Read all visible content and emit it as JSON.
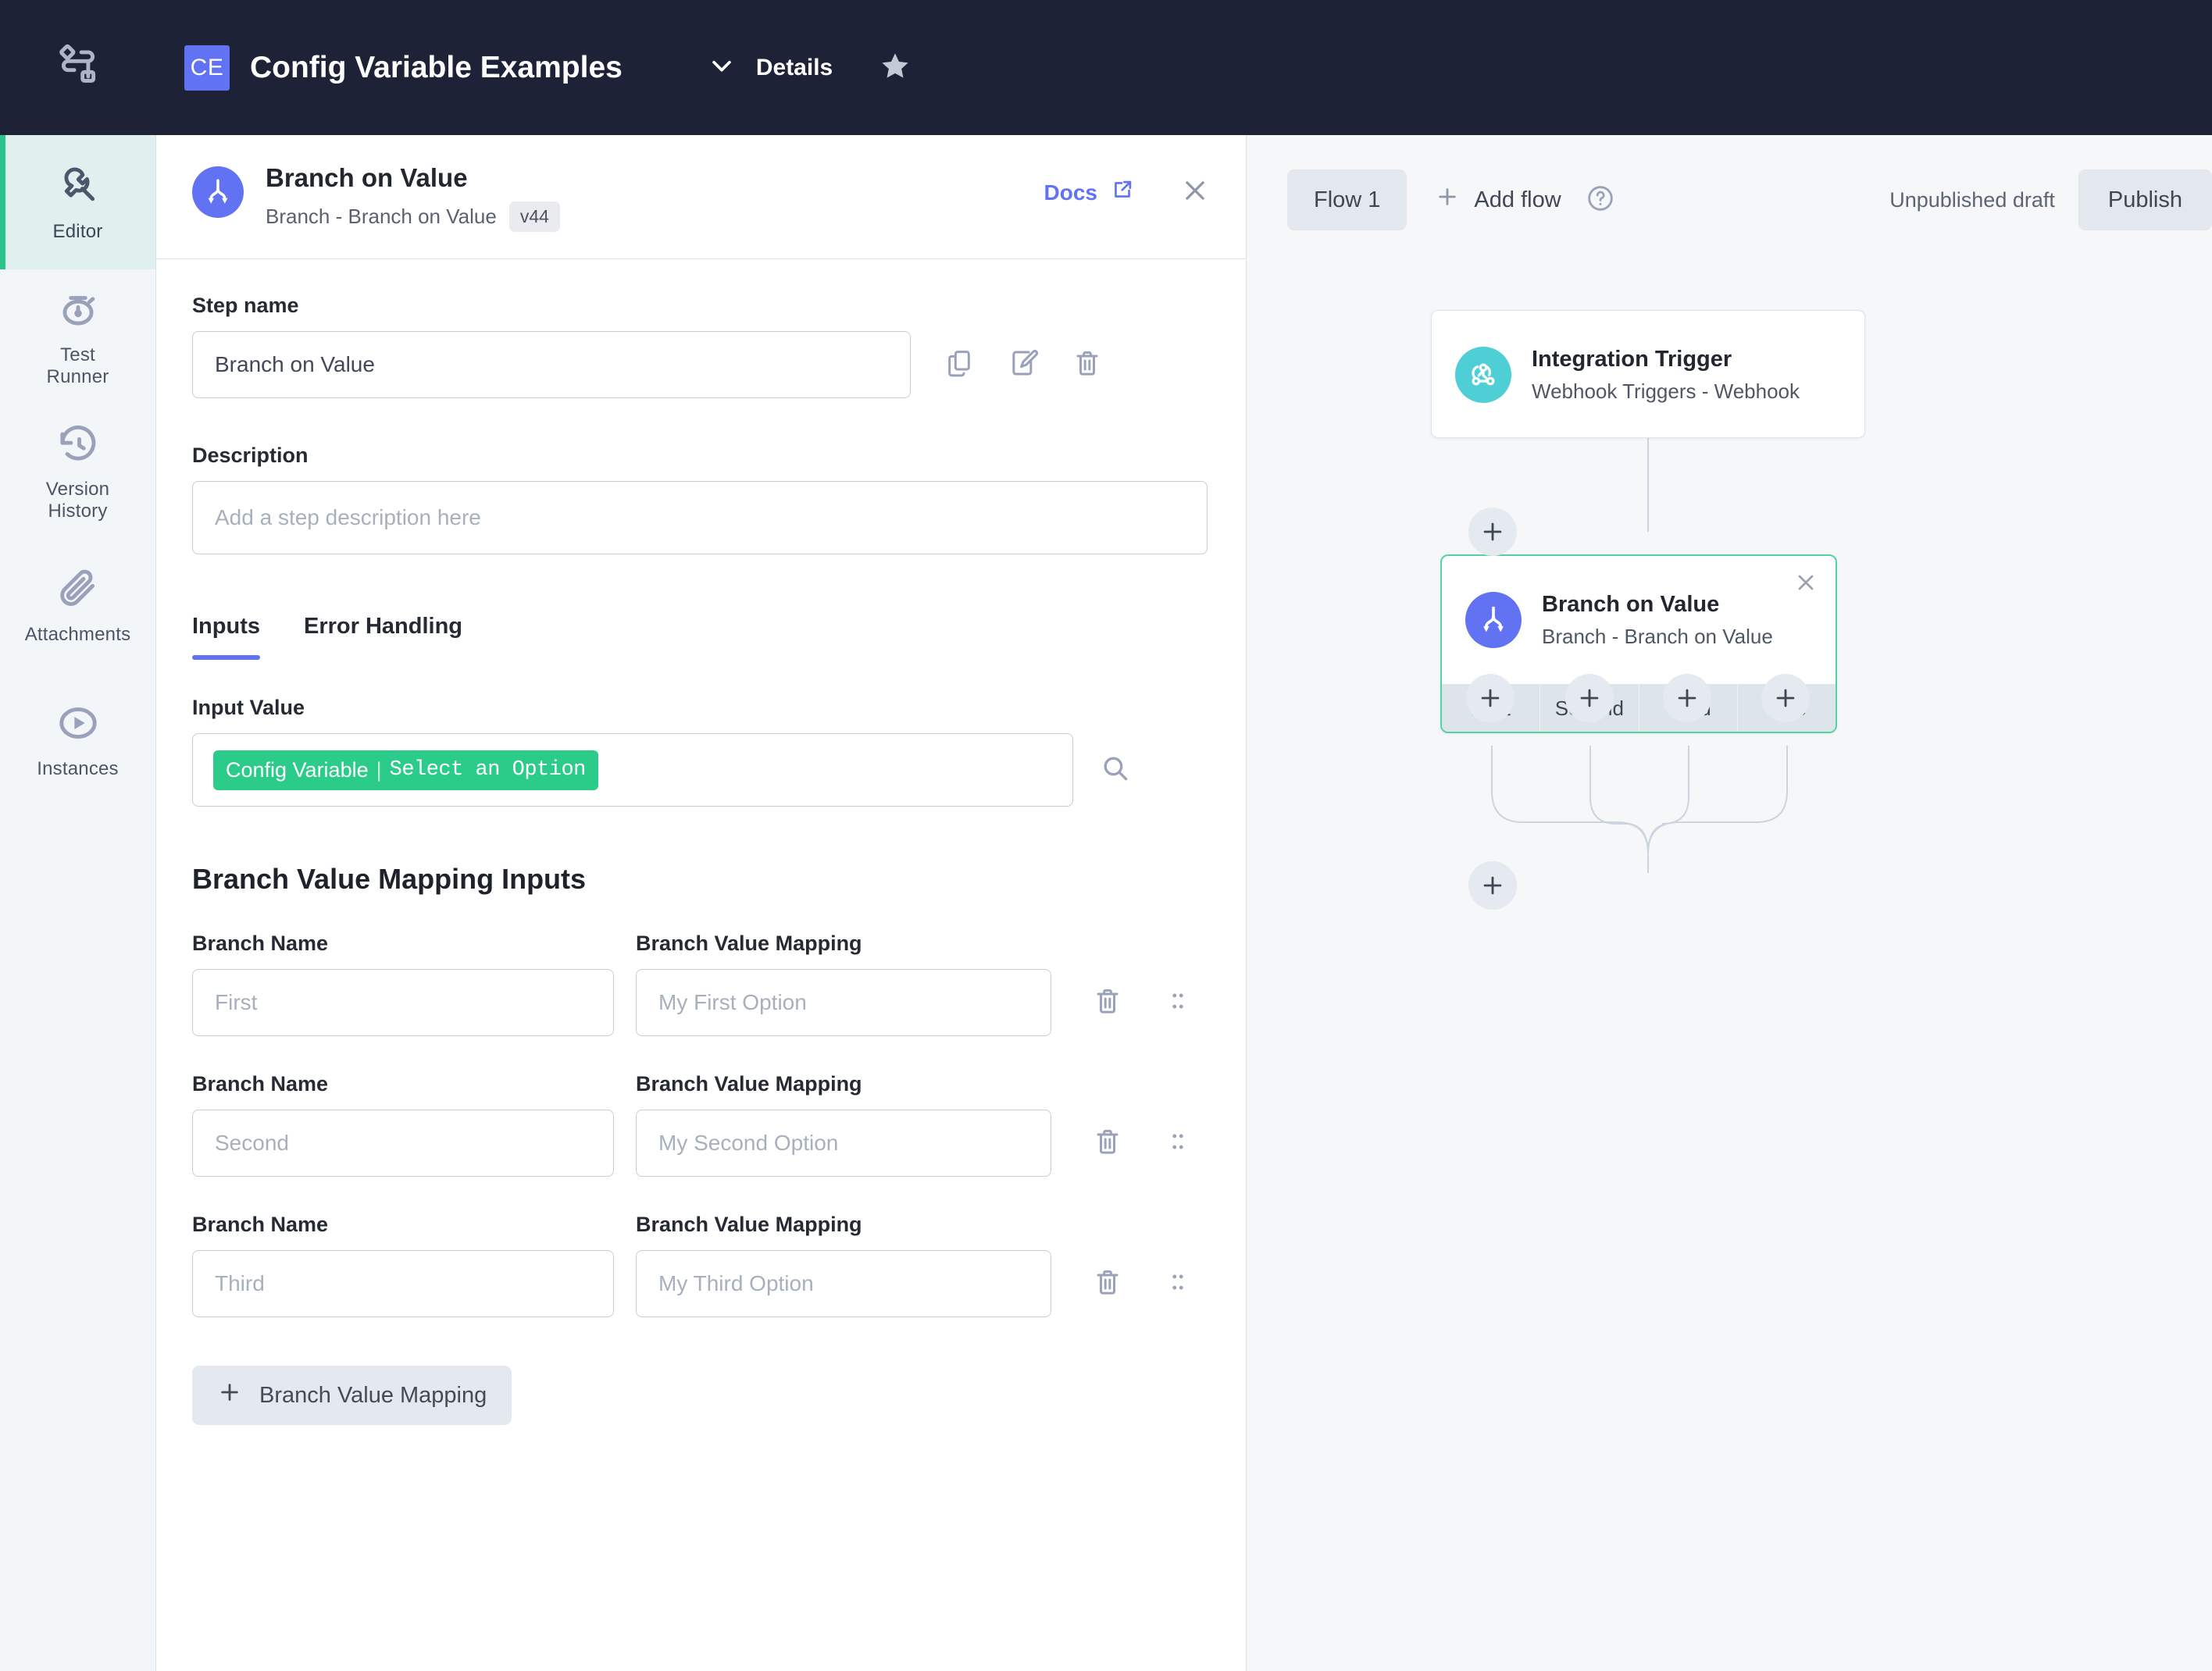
{
  "topbar": {
    "logo_icon": "workflow-logo-icon",
    "app_initials": "CE",
    "app_title": "Config Variable Examples",
    "details_label": "Details",
    "chevron_icon": "chevron-down-icon",
    "star_icon": "star-icon"
  },
  "rail": {
    "items": [
      {
        "label": "Editor",
        "icon": "wrench-icon",
        "active": true
      },
      {
        "label": "Test\nRunner",
        "icon": "stopwatch-icon",
        "active": false
      },
      {
        "label": "Version\nHistory",
        "icon": "history-icon",
        "active": false
      },
      {
        "label": "Attachments",
        "icon": "paperclip-icon",
        "active": false
      },
      {
        "label": "Instances",
        "icon": "play-circle-icon",
        "active": false
      }
    ],
    "labels": {
      "editor": "Editor",
      "test_runner_l1": "Test",
      "test_runner_l2": "Runner",
      "version_l1": "Version",
      "version_l2": "History",
      "attachments": "Attachments",
      "instances": "Instances"
    }
  },
  "panel": {
    "header": {
      "icon": "branch-on-value-icon",
      "title": "Branch on Value",
      "subtitle": "Branch - Branch on Value",
      "version_chip": "v44",
      "docs_label": "Docs",
      "docs_icon": "external-link-icon",
      "close_icon": "close-icon"
    },
    "step_name": {
      "label": "Step name",
      "value": "Branch on Value",
      "actions": [
        "copy-icon",
        "edit-icon",
        "trash-icon"
      ]
    },
    "description": {
      "label": "Description",
      "value": "",
      "placeholder": "Add a step description here"
    },
    "tabs": [
      {
        "label": "Inputs",
        "active": true
      },
      {
        "label": "Error Handling",
        "active": false
      }
    ],
    "tab_labels": {
      "inputs": "Inputs",
      "error_handling": "Error Handling"
    },
    "input_value": {
      "label": "Input Value",
      "tag_left": "Config Variable",
      "tag_sep": "|",
      "tag_right": "Select an Option",
      "tag_color": "#2bcc8a",
      "search_icon": "search-icon"
    },
    "mapping": {
      "section_title": "Branch Value Mapping Inputs",
      "col_name_label": "Branch Name",
      "col_value_label": "Branch Value Mapping",
      "rows": [
        {
          "name": "First",
          "value": "My First Option",
          "delete_icon": "trash-icon",
          "drag_icon": "drag-handle-icon"
        },
        {
          "name": "Second",
          "value": "My Second Option",
          "delete_icon": "trash-icon",
          "drag_icon": "drag-handle-icon"
        },
        {
          "name": "Third",
          "value": "My Third Option",
          "delete_icon": "trash-icon",
          "drag_icon": "drag-handle-icon"
        }
      ],
      "add_button_label": "Branch Value Mapping",
      "add_button_icon": "plus-icon"
    }
  },
  "canvas": {
    "toolbar": {
      "flow_chip": "Flow 1",
      "add_flow_label": "Add flow",
      "add_flow_icon": "plus-icon",
      "help_icon": "question-circle-icon",
      "draft_status": "Unpublished draft",
      "publish_label": "Publish"
    },
    "nodes": [
      {
        "id": "trigger",
        "icon": "webhook-icon",
        "icon_color": "#4ecfd6",
        "title": "Integration Trigger",
        "subtitle": "Webhook Triggers - Webhook"
      },
      {
        "id": "branch",
        "icon": "branch-on-value-icon",
        "icon_color": "#6172f3",
        "title": "Branch on Value",
        "subtitle": "Branch - Branch on Value",
        "close_icon": "close-icon",
        "selected_border": "#54d3a2",
        "branches": [
          "First",
          "Second",
          "Third",
          "Else"
        ]
      }
    ],
    "add_step_buttons": 6
  },
  "colors": {
    "topbar_bg": "#1e2236",
    "accent_indigo": "#6172f3",
    "accent_green": "#2bc48a",
    "tag_green": "#2bcc8a",
    "trigger_teal": "#4ecfd6",
    "canvas_bg": "#f5f7f9",
    "rail_bg": "#f3f6f8",
    "rail_active_bg": "#dff0ef"
  }
}
